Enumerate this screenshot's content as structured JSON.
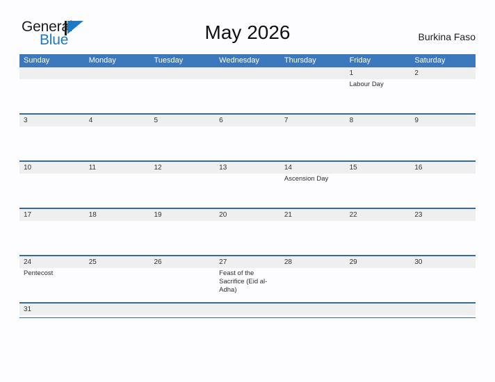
{
  "brand": {
    "word_one": "General",
    "word_two": "Blue",
    "flag_icon": "blue-triangle-flag-icon",
    "accent_color": "#1d78c6"
  },
  "header": {
    "title": "May 2026",
    "country": "Burkina Faso"
  },
  "colors": {
    "header_blue": "#3c78bd",
    "row_divider_blue": "#2d6ca8",
    "daynum_band_gray": "#efefef",
    "page_background": "#fdfdff"
  },
  "calendar": {
    "weekdays": [
      "Sunday",
      "Monday",
      "Tuesday",
      "Wednesday",
      "Thursday",
      "Friday",
      "Saturday"
    ],
    "weeks": [
      {
        "days": [
          {
            "num": "",
            "event": ""
          },
          {
            "num": "",
            "event": ""
          },
          {
            "num": "",
            "event": ""
          },
          {
            "num": "",
            "event": ""
          },
          {
            "num": "",
            "event": ""
          },
          {
            "num": "1",
            "event": "Labour Day"
          },
          {
            "num": "2",
            "event": ""
          }
        ]
      },
      {
        "days": [
          {
            "num": "3",
            "event": ""
          },
          {
            "num": "4",
            "event": ""
          },
          {
            "num": "5",
            "event": ""
          },
          {
            "num": "6",
            "event": ""
          },
          {
            "num": "7",
            "event": ""
          },
          {
            "num": "8",
            "event": ""
          },
          {
            "num": "9",
            "event": ""
          }
        ]
      },
      {
        "days": [
          {
            "num": "10",
            "event": ""
          },
          {
            "num": "11",
            "event": ""
          },
          {
            "num": "12",
            "event": ""
          },
          {
            "num": "13",
            "event": ""
          },
          {
            "num": "14",
            "event": "Ascension Day"
          },
          {
            "num": "15",
            "event": ""
          },
          {
            "num": "16",
            "event": ""
          }
        ]
      },
      {
        "days": [
          {
            "num": "17",
            "event": ""
          },
          {
            "num": "18",
            "event": ""
          },
          {
            "num": "19",
            "event": ""
          },
          {
            "num": "20",
            "event": ""
          },
          {
            "num": "21",
            "event": ""
          },
          {
            "num": "22",
            "event": ""
          },
          {
            "num": "23",
            "event": ""
          }
        ]
      },
      {
        "days": [
          {
            "num": "24",
            "event": "Pentecost"
          },
          {
            "num": "25",
            "event": ""
          },
          {
            "num": "26",
            "event": ""
          },
          {
            "num": "27",
            "event": "Feast of the Sacrifice (Eid al-Adha)"
          },
          {
            "num": "28",
            "event": ""
          },
          {
            "num": "29",
            "event": ""
          },
          {
            "num": "30",
            "event": ""
          }
        ]
      },
      {
        "days": [
          {
            "num": "31",
            "event": ""
          },
          {
            "num": "",
            "event": ""
          },
          {
            "num": "",
            "event": ""
          },
          {
            "num": "",
            "event": ""
          },
          {
            "num": "",
            "event": ""
          },
          {
            "num": "",
            "event": ""
          },
          {
            "num": "",
            "event": ""
          }
        ]
      }
    ]
  }
}
